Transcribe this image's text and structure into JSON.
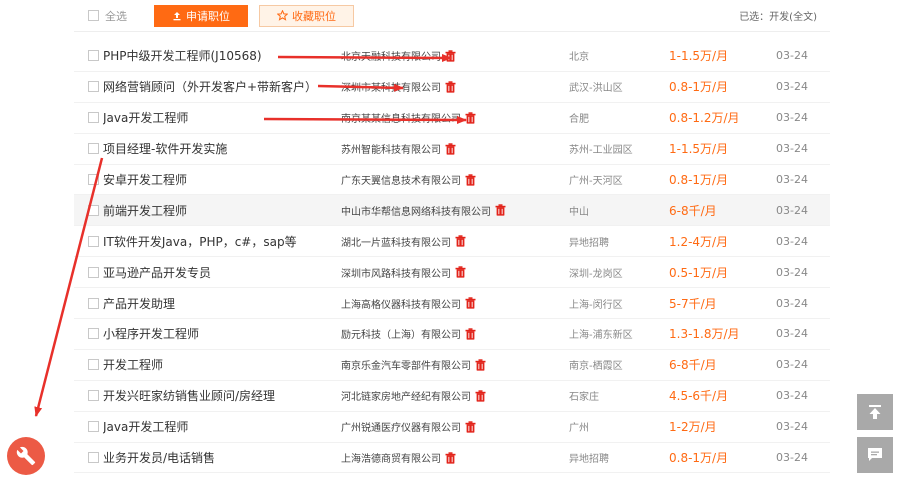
{
  "toolbar": {
    "select_all": "全选",
    "apply_label": "申请职位",
    "fav_label": "收藏职位",
    "selected_info": "已选：开发(全文)"
  },
  "jobs": [
    {
      "title": "PHP中级开发工程师(J10568)",
      "company": "北京天融科技有限公司",
      "location": "北京",
      "salary": "1-1.5万/月",
      "date": "03-24"
    },
    {
      "title": "网络营销顾问（外开发客户+带新客户）",
      "company": "深圳市某科技有限公司",
      "location": "武汉-洪山区",
      "salary": "0.8-1万/月",
      "date": "03-24"
    },
    {
      "title": "Java开发工程师",
      "company": "南京某某信息科技有限公司",
      "location": "合肥",
      "salary": "0.8-1.2万/月",
      "date": "03-24"
    },
    {
      "title": "项目经理-软件开发实施",
      "company": "苏州智能科技有限公司",
      "location": "苏州-工业园区",
      "salary": "1-1.5万/月",
      "date": "03-24"
    },
    {
      "title": "安卓开发工程师",
      "company": "广东天翼信息技术有限公司",
      "location": "广州-天河区",
      "salary": "0.8-1万/月",
      "date": "03-24"
    },
    {
      "title": "前端开发工程师",
      "company": "中山市华帮信息网络科技有限公司",
      "location": "中山",
      "salary": "6-8千/月",
      "date": "03-24"
    },
    {
      "title": "IT软件开发Java，PHP，c#，sap等",
      "company": "湖北一片蓝科技有限公司",
      "location": "异地招聘",
      "salary": "1.2-4万/月",
      "date": "03-24"
    },
    {
      "title": "亚马逊产品开发专员",
      "company": "深圳市风路科技有限公司",
      "location": "深圳-龙岗区",
      "salary": "0.5-1万/月",
      "date": "03-24"
    },
    {
      "title": "产品开发助理",
      "company": "上海高格仪器科技有限公司",
      "location": "上海-闵行区",
      "salary": "5-7千/月",
      "date": "03-24"
    },
    {
      "title": "小程序开发工程师",
      "company": "励元科技（上海）有限公司",
      "location": "上海-浦东新区",
      "salary": "1.3-1.8万/月",
      "date": "03-24"
    },
    {
      "title": "开发工程师",
      "company": "南京乐金汽车零部件有限公司",
      "location": "南京-栖霞区",
      "salary": "6-8千/月",
      "date": "03-24"
    },
    {
      "title": "开发兴旺家纺销售业顾问/房经理",
      "company": "河北链家房地产经纪有限公司",
      "location": "石家庄",
      "salary": "4.5-6千/月",
      "date": "03-24"
    },
    {
      "title": "Java开发工程师",
      "company": "广州锐通医疗仪器有限公司",
      "location": "广州",
      "salary": "1-2万/月",
      "date": "03-24"
    },
    {
      "title": "业务开发员/电话销售",
      "company": "上海浩德商贸有限公司",
      "location": "异地招聘",
      "salary": "0.8-1万/月",
      "date": "03-24"
    }
  ],
  "icons": {
    "trash": "trash-icon",
    "wrench": "wrench-icon",
    "back_to_top": "back-to-top-icon",
    "feedback": "comment-icon"
  },
  "colors": {
    "accent": "#ff6a13",
    "arrow": "#e8302a",
    "wrench_bg": "#ec5a45",
    "side_btn": "#a9a9a9"
  }
}
